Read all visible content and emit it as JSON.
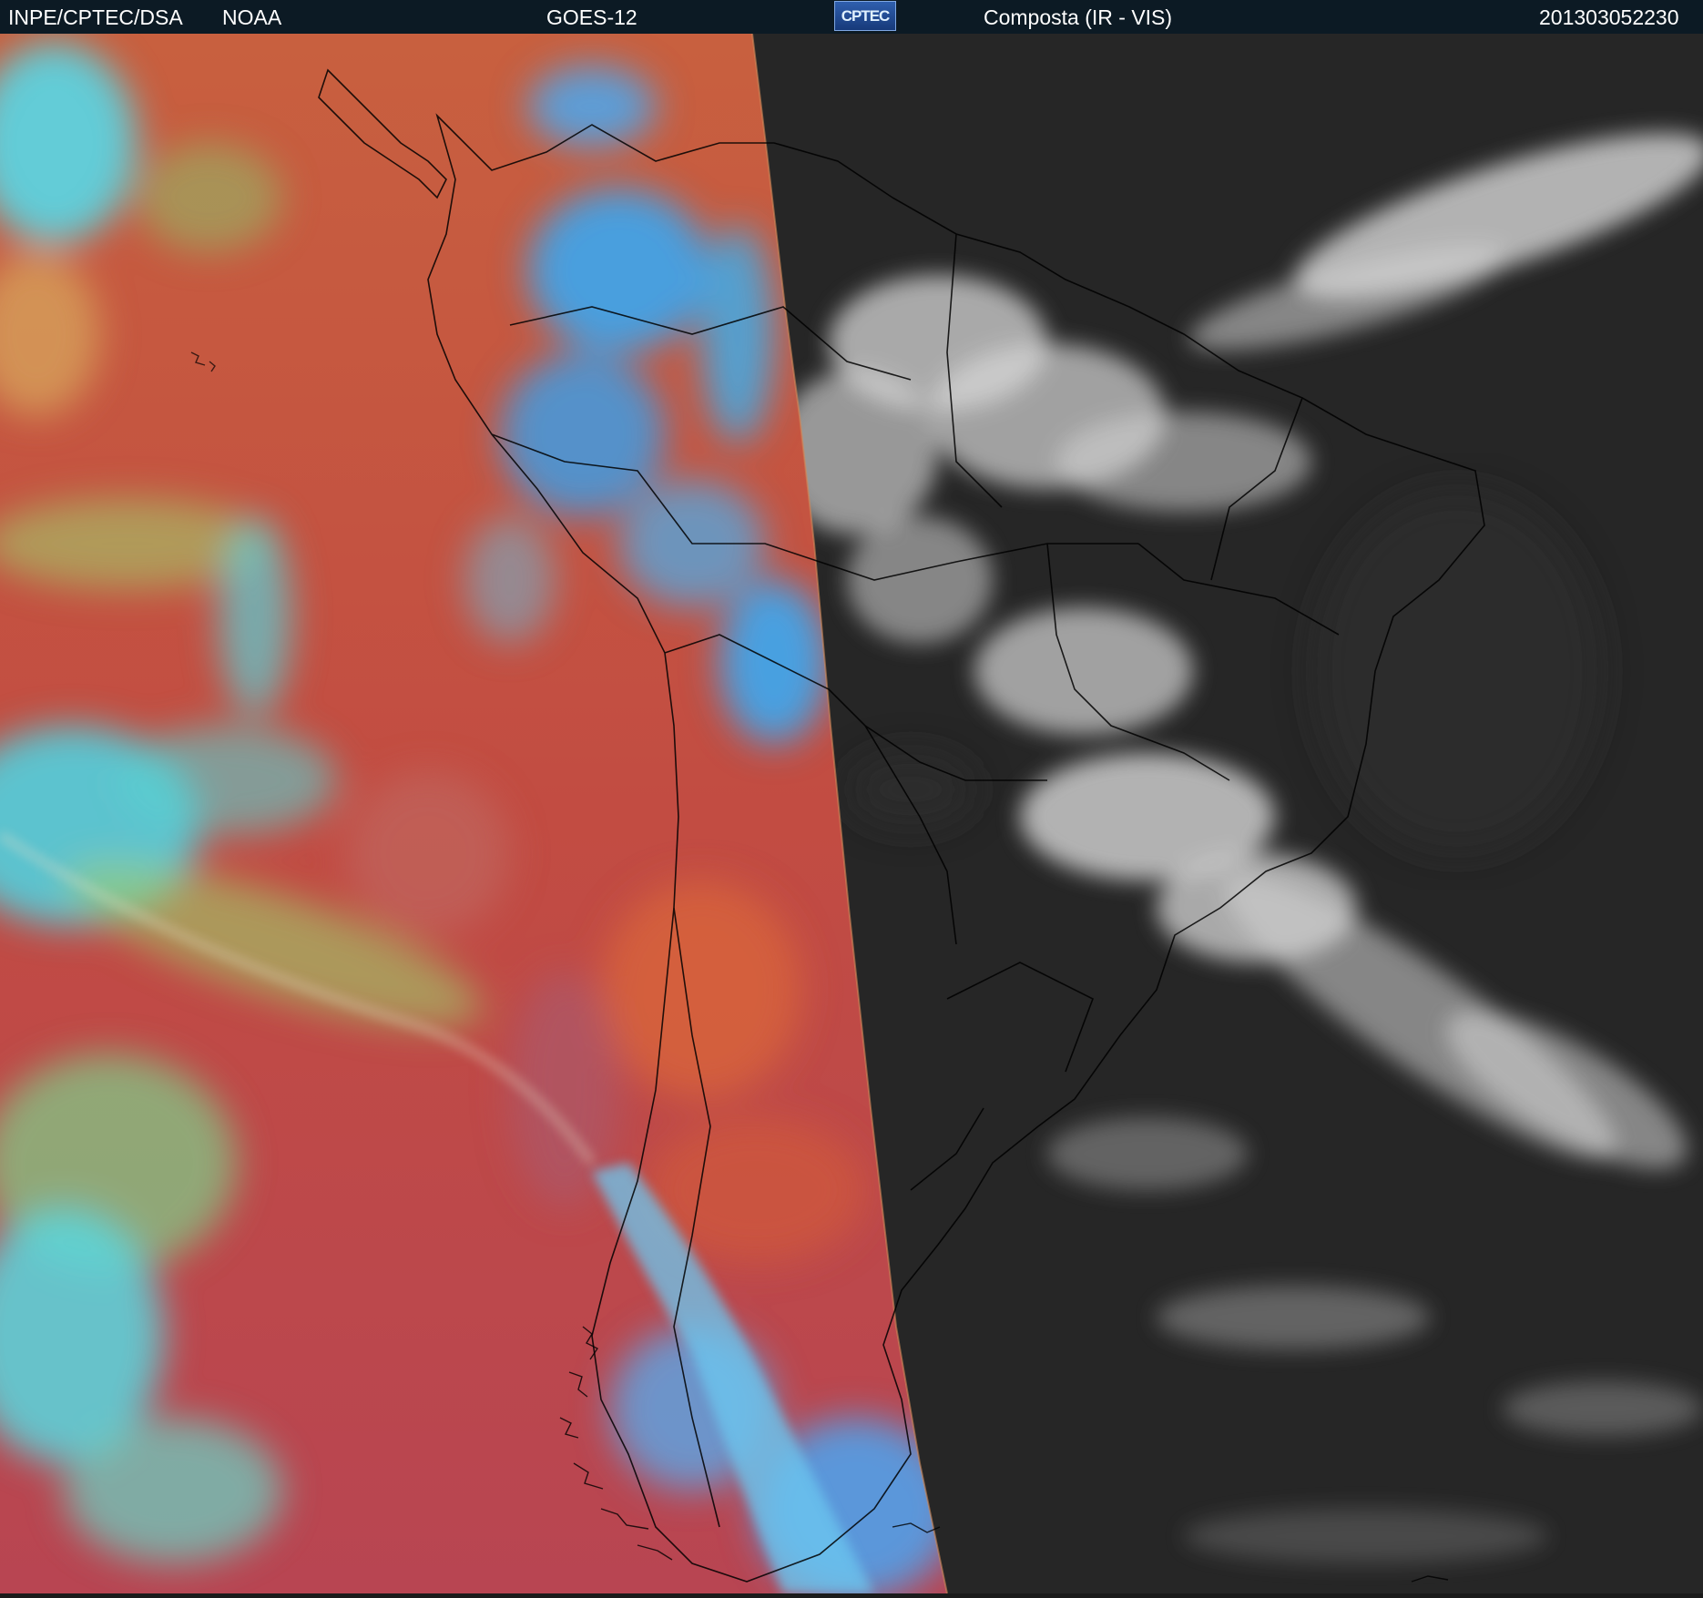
{
  "header": {
    "agency": "INPE/CPTEC/DSA",
    "source": "NOAA",
    "satellite": "GOES-12",
    "logo_text": "CPTEC",
    "product": "Composta (IR - VIS)",
    "timestamp": "201303052230"
  },
  "colors": {
    "header_bg": "#0c1a24",
    "ir_warm": "#c45a4a",
    "ir_cloud": "#38b8e0",
    "ir_mid": "#9ec25a",
    "vis_bg": "#262626",
    "vis_cloud": "#d8d8d8",
    "borders": "#000000"
  }
}
